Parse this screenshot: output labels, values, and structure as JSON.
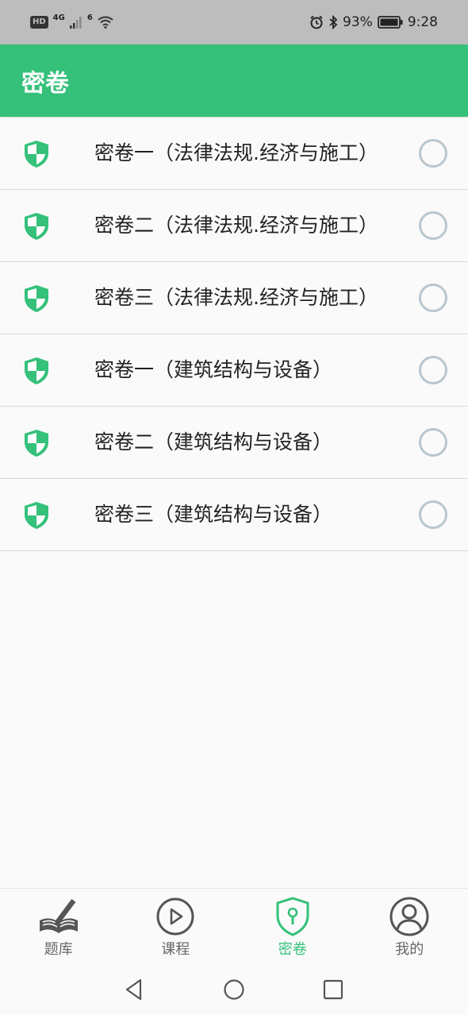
{
  "status_bar": {
    "hd": "HD",
    "network_1": "4G",
    "network_2": "6",
    "battery_percent": "93%",
    "time": "9:28"
  },
  "app_bar": {
    "title": "密卷"
  },
  "list": {
    "items": [
      {
        "label": "密卷一（法律法规.经济与施工）"
      },
      {
        "label": "密卷二（法律法规.经济与施工）"
      },
      {
        "label": "密卷三（法律法规.经济与施工）"
      },
      {
        "label": "密卷一（建筑结构与设备）"
      },
      {
        "label": "密卷二（建筑结构与设备）"
      },
      {
        "label": "密卷三（建筑结构与设备）"
      }
    ]
  },
  "bottom_nav": {
    "items": [
      {
        "label": "题库",
        "icon": "book-pencil-icon",
        "active": false
      },
      {
        "label": "课程",
        "icon": "play-circle-icon",
        "active": false
      },
      {
        "label": "密卷",
        "icon": "shield-lock-icon",
        "active": true
      },
      {
        "label": "我的",
        "icon": "person-circle-icon",
        "active": false
      }
    ]
  },
  "colors": {
    "accent": "#35c17a",
    "status_bar_bg": "#bdbdbd",
    "radio_border": "#b8c6cf",
    "inactive_nav": "#666666"
  }
}
